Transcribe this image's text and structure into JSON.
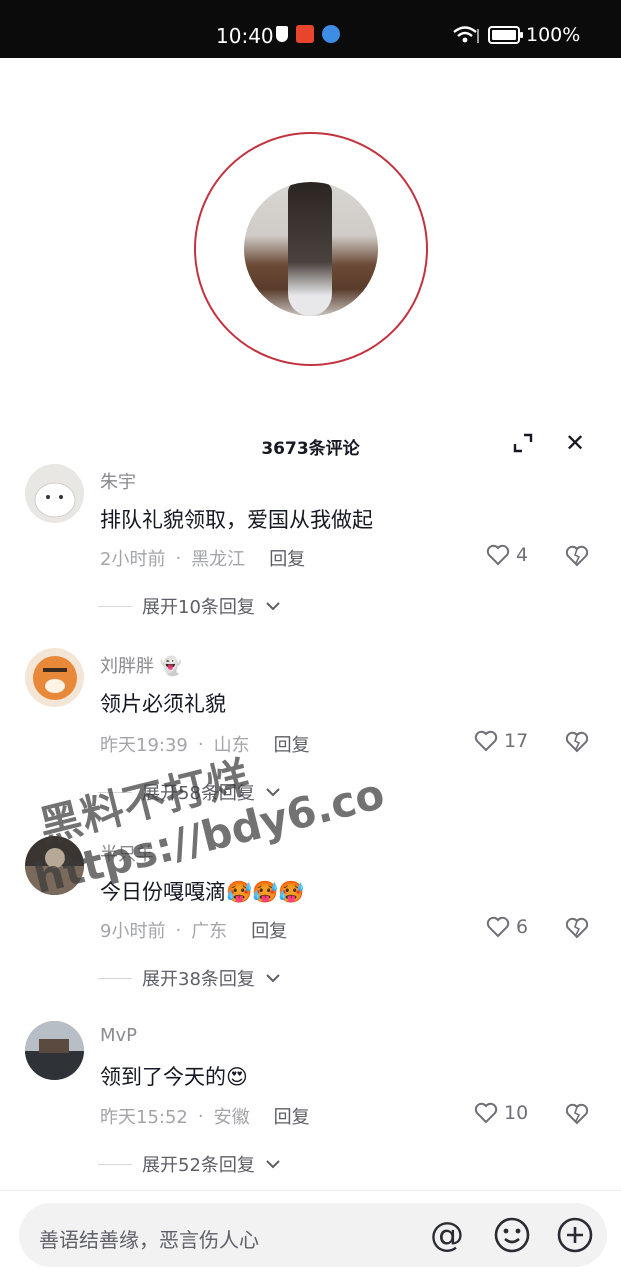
{
  "status_bar": {
    "time": "10:40",
    "battery": "100%",
    "battery_level": 1.0
  },
  "sheet": {
    "title": "3673条评论"
  },
  "comments": [
    {
      "username": "朱宇",
      "text": "排队礼貌领取，爱国从我做起",
      "time": "2小时前",
      "location": "黑龙江",
      "reply_label": "回复",
      "likes": "4",
      "expand": "展开10条回复"
    },
    {
      "username": "刘胖胖",
      "text": "领片必须礼貌",
      "time": "昨天19:39",
      "location": "山东",
      "reply_label": "回复",
      "likes": "17",
      "expand": "展开58条回复"
    },
    {
      "username": "半只羊",
      "text": "今日份嘎嘎滴🥵🥵🥵",
      "time": "9小时前",
      "location": "广东",
      "reply_label": "回复",
      "likes": "6",
      "expand": "展开38条回复"
    },
    {
      "username": "MvP",
      "text": "领到了今天的😍",
      "time": "昨天15:52",
      "location": "安徽",
      "reply_label": "回复",
      "likes": "10",
      "expand": "展开52条回复"
    }
  ],
  "watermark": {
    "line1": "黑料不打烊",
    "line2": "https://bdy6.co"
  },
  "input": {
    "placeholder": "善语结善缘，恶言伤人心"
  },
  "colors": {
    "ring": "#c2333f",
    "text_primary": "#161823",
    "text_secondary": "#8a8b91"
  },
  "icons": [
    "shield-icon",
    "wifi-icon",
    "battery-icon",
    "expand-icon",
    "close-icon",
    "heart-icon",
    "dislike-icon",
    "chevron-down-icon",
    "at-icon",
    "emoji-icon",
    "plus-icon"
  ]
}
